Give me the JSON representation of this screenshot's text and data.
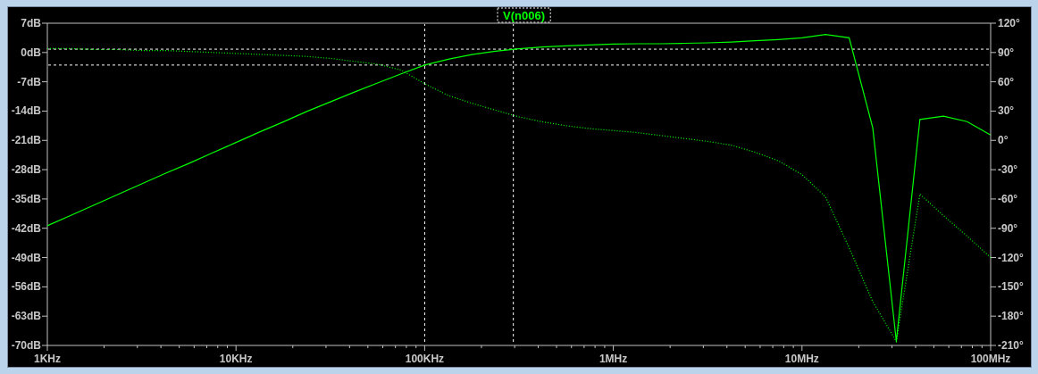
{
  "magnitude_plot": {
    "chart_data": {
      "type": "line",
      "categories": [
        "1KHz",
        null,
        null,
        null,
        null,
        null,
        null,
        null,
        "10KHz",
        null,
        null,
        null,
        null,
        null,
        null,
        null,
        "100KHz",
        null,
        null,
        null,
        null,
        null,
        null,
        null,
        "1MHz",
        null,
        null,
        null,
        null,
        null,
        null,
        null,
        "10MHz",
        null,
        null,
        null,
        null,
        null,
        null,
        null,
        "100MHz"
      ],
      "series": [
        {
          "name": "V(n006)",
          "color": "#00ff00",
          "values": [
            -41.4,
            -38.9,
            -36.4,
            -33.9,
            -31.4,
            -28.9,
            -26.5,
            -24.0,
            -21.5,
            -19.0,
            -16.6,
            -14.1,
            -11.8,
            -9.5,
            -7.3,
            -5.1,
            -3.0,
            -1.6,
            -0.5,
            0.3,
            0.9,
            1.3,
            1.6,
            1.8,
            2.0,
            2.1,
            2.1,
            2.2,
            2.3,
            2.5,
            2.8,
            3.1,
            3.5,
            4.3,
            3.5,
            -18,
            -69,
            -16,
            -15.2,
            -16.5,
            -19.7
          ]
        }
      ],
      "ylim": [
        -70,
        7
      ],
      "ref_lines": [
        {
          "axis": "y",
          "value": 0.8
        },
        {
          "axis": "y",
          "value": -3
        }
      ],
      "yticks": [
        {
          "value": 7,
          "label": "7dB"
        },
        {
          "value": 0,
          "label": "0dB"
        },
        {
          "value": -7,
          "label": "-7dB"
        },
        {
          "value": -14,
          "label": "-14dB"
        },
        {
          "value": -21,
          "label": "-21dB"
        },
        {
          "value": -28,
          "label": "-28dB"
        },
        {
          "value": -35,
          "label": "-35dB"
        },
        {
          "value": -42,
          "label": "-42dB"
        },
        {
          "value": -49,
          "label": "-49dB"
        },
        {
          "value": -56,
          "label": "-56dB"
        },
        {
          "value": -63,
          "label": "-63dB"
        },
        {
          "value": -70,
          "label": "-70dB"
        }
      ]
    }
  },
  "phase_plot": {
    "chart_data": {
      "type": "line",
      "series": [
        {
          "color": "#00ff00",
          "line_style": "dotted",
          "values": [
            94,
            94,
            93,
            93,
            92,
            92,
            91,
            90,
            89,
            88,
            87,
            86,
            84,
            81,
            78,
            72,
            58,
            46,
            38,
            31,
            24,
            19,
            15,
            12,
            10,
            8,
            5,
            2,
            -1,
            -5,
            -12,
            -21,
            -35,
            -58,
            -110,
            -165,
            -206,
            -55,
            -77,
            -98,
            -120
          ]
        }
      ],
      "ylim": [
        -210,
        120
      ],
      "yticks": [
        {
          "value": 120,
          "label": "120°"
        },
        {
          "value": 90,
          "label": "90°"
        },
        {
          "value": 60,
          "label": "60°"
        },
        {
          "value": 30,
          "label": "30°"
        },
        {
          "value": 0,
          "label": "0°"
        },
        {
          "value": -30,
          "label": "-30°"
        },
        {
          "value": -60,
          "label": "-60°"
        },
        {
          "value": -90,
          "label": "-90°"
        },
        {
          "value": -120,
          "label": "-120°"
        },
        {
          "value": -150,
          "label": "-150°"
        },
        {
          "value": -180,
          "label": "-180°"
        },
        {
          "value": -210,
          "label": "-210°"
        }
      ]
    }
  },
  "cursors": [
    {
      "kind": "vertical",
      "level": 0.4
    },
    {
      "kind": "vertical",
      "level": 0.494
    }
  ]
}
